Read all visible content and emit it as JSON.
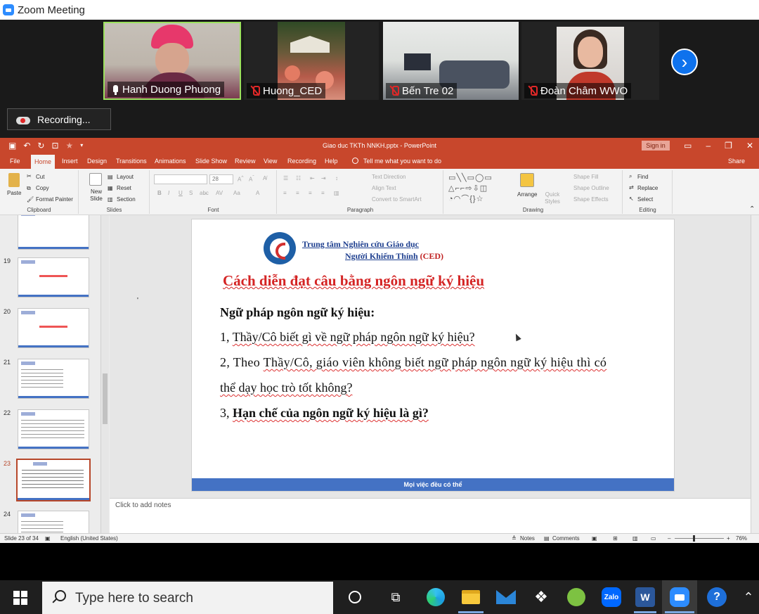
{
  "zoom": {
    "window_title": "Zoom Meeting",
    "participants": [
      {
        "name": "Hanh Duong Phuong",
        "status_icon": "raise-hand-icon"
      },
      {
        "name": "Huong_CED",
        "status_icon": "mic-muted-icon"
      },
      {
        "name": "Bến Tre 02",
        "status_icon": "mic-muted-icon"
      },
      {
        "name": "Đoàn Châm WWO",
        "status_icon": "mic-muted-icon"
      }
    ],
    "next_icon": "chevron-right-icon",
    "recording_label": "Recording...",
    "accent_color": "#2D8CFF"
  },
  "powerpoint": {
    "doc_title": "Giao duc TKTh NNKH.pptx - PowerPoint",
    "sign_in": "Sign in",
    "tabs": [
      "File",
      "Home",
      "Insert",
      "Design",
      "Transitions",
      "Animations",
      "Slide Show",
      "Review",
      "View",
      "Recording",
      "Help"
    ],
    "tell_me": "Tell me what you want to do",
    "share": "Share",
    "ribbon": {
      "clipboard": {
        "label": "Clipboard",
        "paste": "Paste",
        "cut": "Cut",
        "copy": "Copy",
        "format_painter": "Format Painter"
      },
      "slides": {
        "label": "Slides",
        "new_slide": "New Slide",
        "layout": "Layout",
        "reset": "Reset",
        "section": "Section"
      },
      "font": {
        "label": "Font",
        "size": "28"
      },
      "paragraph": {
        "label": "Paragraph",
        "text_direction": "Text Direction",
        "align_text": "Align Text",
        "convert_smartart": "Convert to SmartArt"
      },
      "drawing": {
        "label": "Drawing",
        "arrange": "Arrange",
        "quick_styles": "Quick Styles",
        "shape_fill": "Shape Fill",
        "shape_outline": "Shape Outline",
        "shape_effects": "Shape Effects"
      },
      "editing": {
        "label": "Editing",
        "find": "Find",
        "replace": "Replace",
        "select": "Select"
      }
    },
    "thumbnails": [
      {
        "number": ""
      },
      {
        "number": "19"
      },
      {
        "number": "20"
      },
      {
        "number": "21"
      },
      {
        "number": "22"
      },
      {
        "number": "23",
        "selected": true
      },
      {
        "number": "24"
      }
    ],
    "slide": {
      "org_line1": "Trung tâm Nghiên cứu Giáo dục",
      "org_line2_a": "Người Khiếm Thính",
      "org_line2_b": "(CED)",
      "title": "Cách diễn đạt câu bằng ngôn ngữ ký hiệu",
      "heading": "Ngữ pháp ngôn ngữ ký hiệu:",
      "q1_prefix": "1, ",
      "q1": "Thầy/Cô biết gì về ngữ pháp ngôn ngữ ký hiệu?",
      "q2_prefix": "2, Theo ",
      "q2": "Thầy/Cô, giáo viên không biết ngữ pháp ngôn ngữ ký hiệu thì có",
      "q2b": "thể dạy học trò tốt không?",
      "q3_prefix": "3, ",
      "q3": "Hạn chế của ngôn ngữ ký hiệu là gì?",
      "footer": "Mọi việc đều có thể",
      "dot": "'"
    },
    "notes_placeholder": "Click to add notes",
    "status": {
      "slide_count": "Slide 23 of 34",
      "language": "English (United States)",
      "notes": "Notes",
      "comments": "Comments",
      "zoom": "76%"
    }
  },
  "taskbar": {
    "search_placeholder": "Type here to search",
    "apps": [
      "cortana-icon",
      "task-view-icon",
      "edge-icon",
      "file-explorer-icon",
      "mail-icon",
      "dropbox-icon",
      "greenshot-icon",
      "zalo-icon",
      "word-icon",
      "zoom-icon",
      "help-icon"
    ],
    "zalo_label": "Zalo",
    "word_label": "W"
  }
}
